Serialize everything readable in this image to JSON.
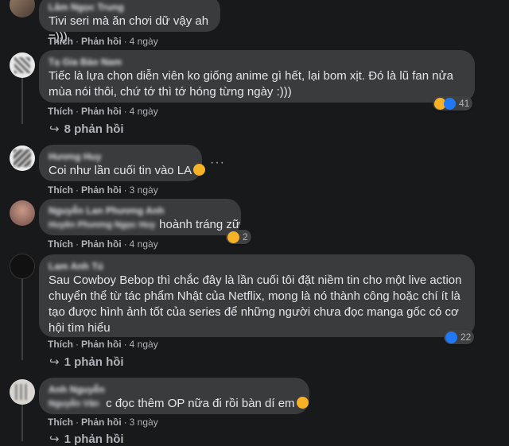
{
  "comments": [
    {
      "name": "Lâm Ngọc Trung",
      "text": "Tivi seri mà ăn chơi dữ vậy ah =)))",
      "like_label": "Thích",
      "reply_label": "Phản hồi",
      "time": "4 ngày"
    },
    {
      "name": "Tạ Gia Bảo Nam",
      "text": "Tiếc là lựa chọn diễn viên ko giống anime gì hết, lại bom xịt. Đó là lũ fan nửa mùa nói thôi, chứ tớ thì tớ hóng từng ngày :)))",
      "like_label": "Thích",
      "reply_label": "Phản hồi",
      "time": "4 ngày",
      "reaction_count": "41",
      "replies": "8 phản hồi"
    },
    {
      "name": "Hương Huy",
      "text": "Coi như lần cuối tin vào LA",
      "like_label": "Thích",
      "reply_label": "Phản hồi",
      "time": "3 ngày",
      "more": "···"
    },
    {
      "name": "Nguyễn Lan Phương Anh",
      "tagged": "Huyền Phương Ngọc Huy",
      "text": "hoành tráng zữ",
      "like_label": "Thích",
      "reply_label": "Phản hồi",
      "time": "4 ngày",
      "reaction_count": "2"
    },
    {
      "name": "Lam Anh Tú",
      "text": "Sau Cowboy Bebop thì chắc đây là lần cuối tôi đặt niềm tin cho một live action chuyển thể từ tác phẩm Nhật của Netflix, mong là nó thành công hoặc chí ít là tạo được hình ảnh tốt của series để những người chưa đọc manga gốc có cơ hội tìm hiểu",
      "like_label": "Thích",
      "reply_label": "Phản hồi",
      "time": "4 ngày",
      "reaction_count": "22",
      "replies": "1 phản hồi"
    },
    {
      "name": "Anh Nguyễn",
      "tagged": "Nguyễn Văn",
      "text": "c đọc thêm OP nữa đi rồi bàn dí em",
      "like_label": "Thích",
      "reply_label": "Phản hồi",
      "time": "3 ngày",
      "replies": "1 phản hồi"
    }
  ],
  "colors": {
    "background": "#18191a",
    "bubble": "#3a3b3c",
    "text": "#e4e6eb",
    "secondary": "#b0b3b8",
    "like_blue": "#2078f4",
    "emoji_yellow": "#f7b125"
  }
}
